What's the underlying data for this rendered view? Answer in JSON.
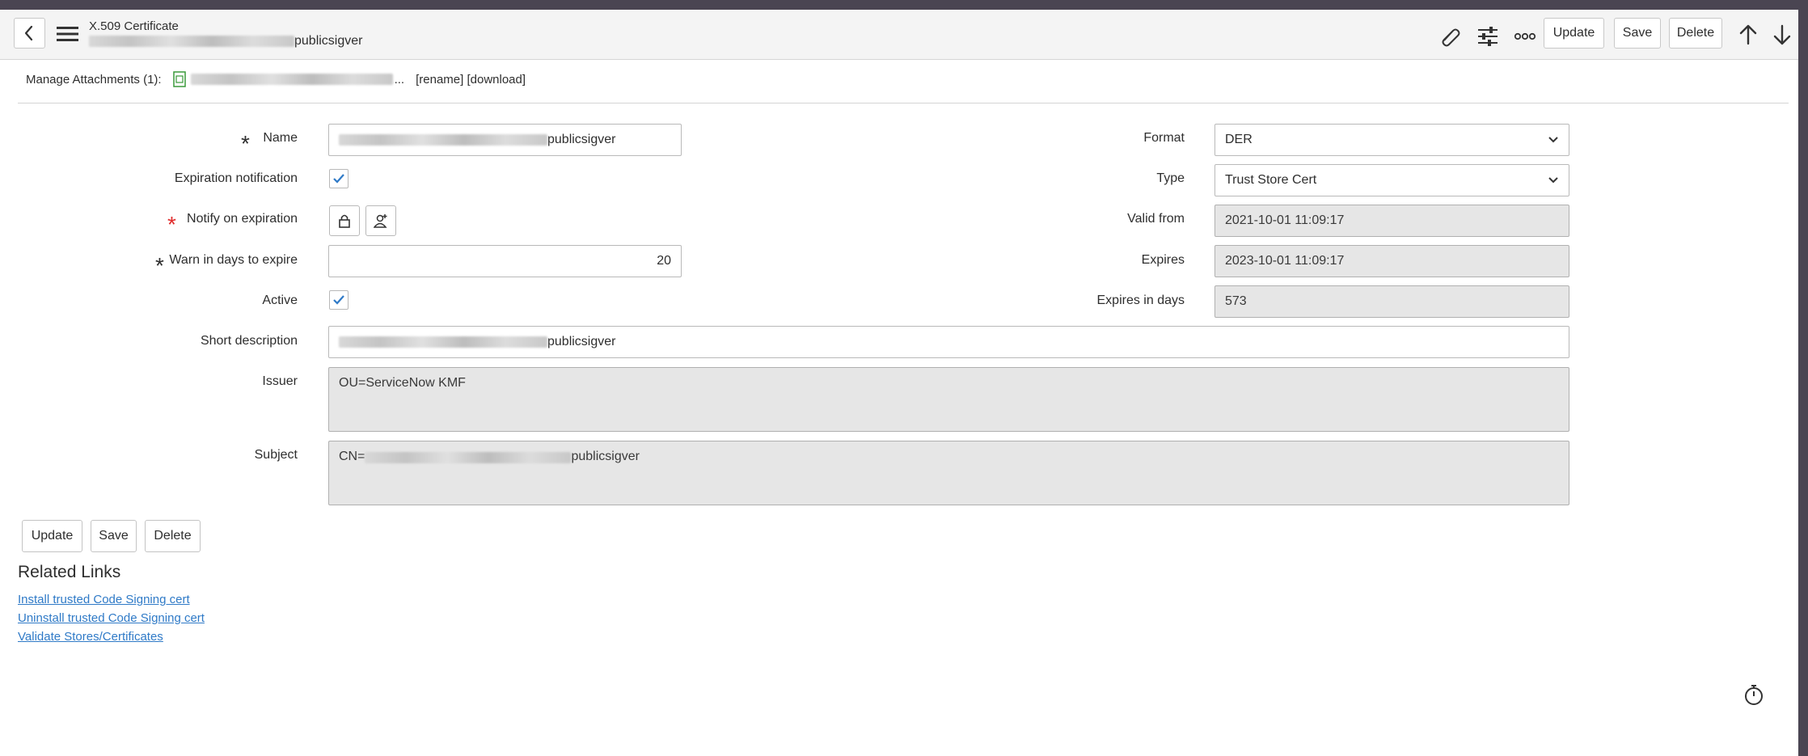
{
  "header": {
    "title": "X.509 Certificate",
    "subtitle_suffix": "publicsigver",
    "buttons": {
      "update": "Update",
      "save": "Save",
      "delete": "Delete"
    }
  },
  "attachments": {
    "label": "Manage Attachments (1):",
    "ellipsis": "...",
    "actions": "[rename] [download]"
  },
  "form": {
    "name": {
      "label": "Name",
      "value_suffix": "publicsigver"
    },
    "expiration_notification": {
      "label": "Expiration notification",
      "checked": true
    },
    "notify_on_expiration": {
      "label": "Notify on expiration"
    },
    "warn_days": {
      "label": "Warn in days to expire",
      "value": "20"
    },
    "active": {
      "label": "Active",
      "checked": true
    },
    "short_description": {
      "label": "Short description",
      "value_suffix": "publicsigver"
    },
    "issuer": {
      "label": "Issuer",
      "value": "OU=ServiceNow KMF"
    },
    "subject": {
      "label": "Subject",
      "value_prefix": "CN=",
      "value_suffix": "publicsigver"
    },
    "format": {
      "label": "Format",
      "value": "DER"
    },
    "type": {
      "label": "Type",
      "value": "Trust Store Cert"
    },
    "valid_from": {
      "label": "Valid from",
      "value": "2021-10-01 11:09:17"
    },
    "expires": {
      "label": "Expires",
      "value": "2023-10-01 11:09:17"
    },
    "expires_in_days": {
      "label": "Expires in days",
      "value": "573"
    }
  },
  "bottom_buttons": {
    "update": "Update",
    "save": "Save",
    "delete": "Delete"
  },
  "related_links": {
    "title": "Related Links",
    "items": [
      "Install trusted Code Signing cert",
      "Uninstall trusted Code Signing cert",
      "Validate Stores/Certificates"
    ]
  },
  "colors": {
    "required": "#e02b2b",
    "link": "#2f7ac7",
    "check": "#2f7ac7"
  }
}
